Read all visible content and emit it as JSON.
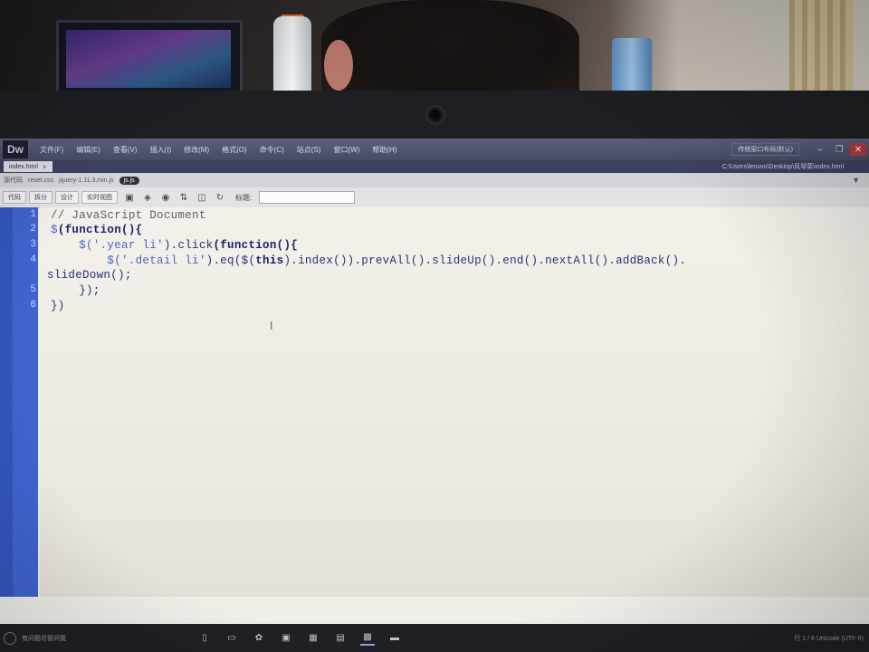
{
  "app": {
    "logo": "Dw",
    "menu": [
      "文件(F)",
      "编辑(E)",
      "查看(V)",
      "插入(I)",
      "修改(M)",
      "格式(O)",
      "命令(C)",
      "站点(S)",
      "窗口(W)",
      "帮助(H)"
    ],
    "workspace": "传统窗口布局(默认)",
    "window_controls": {
      "minimize": "–",
      "restore": "❐",
      "close": "✕"
    }
  },
  "document": {
    "tab_label": "index.html",
    "tab_close": "×",
    "path": "C:\\Users\\lenovo\\Desktop\\风琴菜\\index.html"
  },
  "related_files": {
    "items": [
      "源代码",
      "reset.css",
      "jquery-1.11.3.min.js"
    ],
    "active": "js.js"
  },
  "toolbar": {
    "views": [
      "代码",
      "拆分",
      "设计",
      "实时视图"
    ],
    "title_label": "标题:",
    "title_value": ""
  },
  "editor": {
    "line_numbers": [
      "1",
      "2",
      "3",
      "4",
      "5",
      "6"
    ],
    "lines": [
      {
        "text": "// JavaScript Document"
      },
      {
        "p1": "$",
        "kw1": "(function(){"
      },
      {
        "p1": "    $(",
        "str": "'.year li'",
        "p2": ").click",
        "kw": "(function(){"
      },
      {
        "p1": "        $(",
        "str": "'.detail li'",
        "p2": ").eq($(",
        "kw": "this",
        "p3": ").index()).prevAll().slideUp().end().nextAll().addBack()."
      },
      {
        "wrap": "slideDown();"
      },
      {
        "text": "    });"
      },
      {
        "text": "})"
      }
    ],
    "cursor_glyph": "I"
  },
  "taskbar": {
    "search_placeholder": "有问题尽管问我",
    "apps": [
      "app-1",
      "app-2",
      "app-3",
      "app-4",
      "app-5",
      "app-6",
      "app-7",
      "app-8"
    ],
    "tray_text": "行 1 / 6  Unicode (UTF-8)"
  }
}
